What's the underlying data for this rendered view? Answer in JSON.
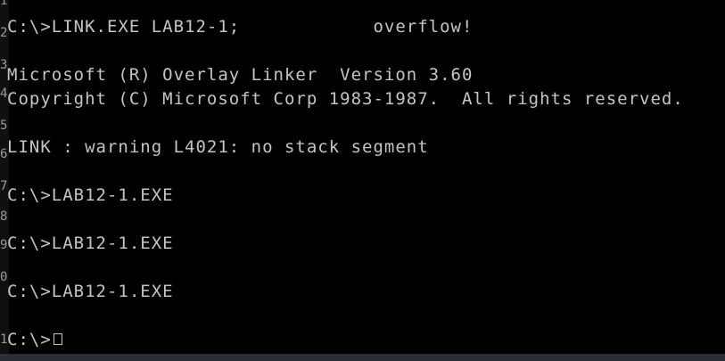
{
  "console": {
    "lines": [
      "C:\\>LINK.EXE LAB12-1;            overflow!",
      "",
      "Microsoft (R) Overlay Linker  Version 3.60",
      "Copyright (C) Microsoft Corp 1983-1987.  All rights reserved.",
      "",
      "LINK : warning L4021: no stack segment",
      "",
      "C:\\>LAB12-1.EXE",
      "",
      "C:\\>LAB12-1.EXE",
      "",
      "C:\\>LAB12-1.EXE",
      "",
      "C:\\>"
    ]
  },
  "gutter": {
    "numbers": [
      "1",
      "2",
      "3",
      "4",
      "5",
      "6",
      "7",
      "8",
      "9",
      "0",
      "1"
    ]
  },
  "colors": {
    "background": "#000000",
    "text": "#c4c4c4",
    "gutter_text": "#9a9a9a",
    "bottom_bar": "#2a2f36"
  }
}
